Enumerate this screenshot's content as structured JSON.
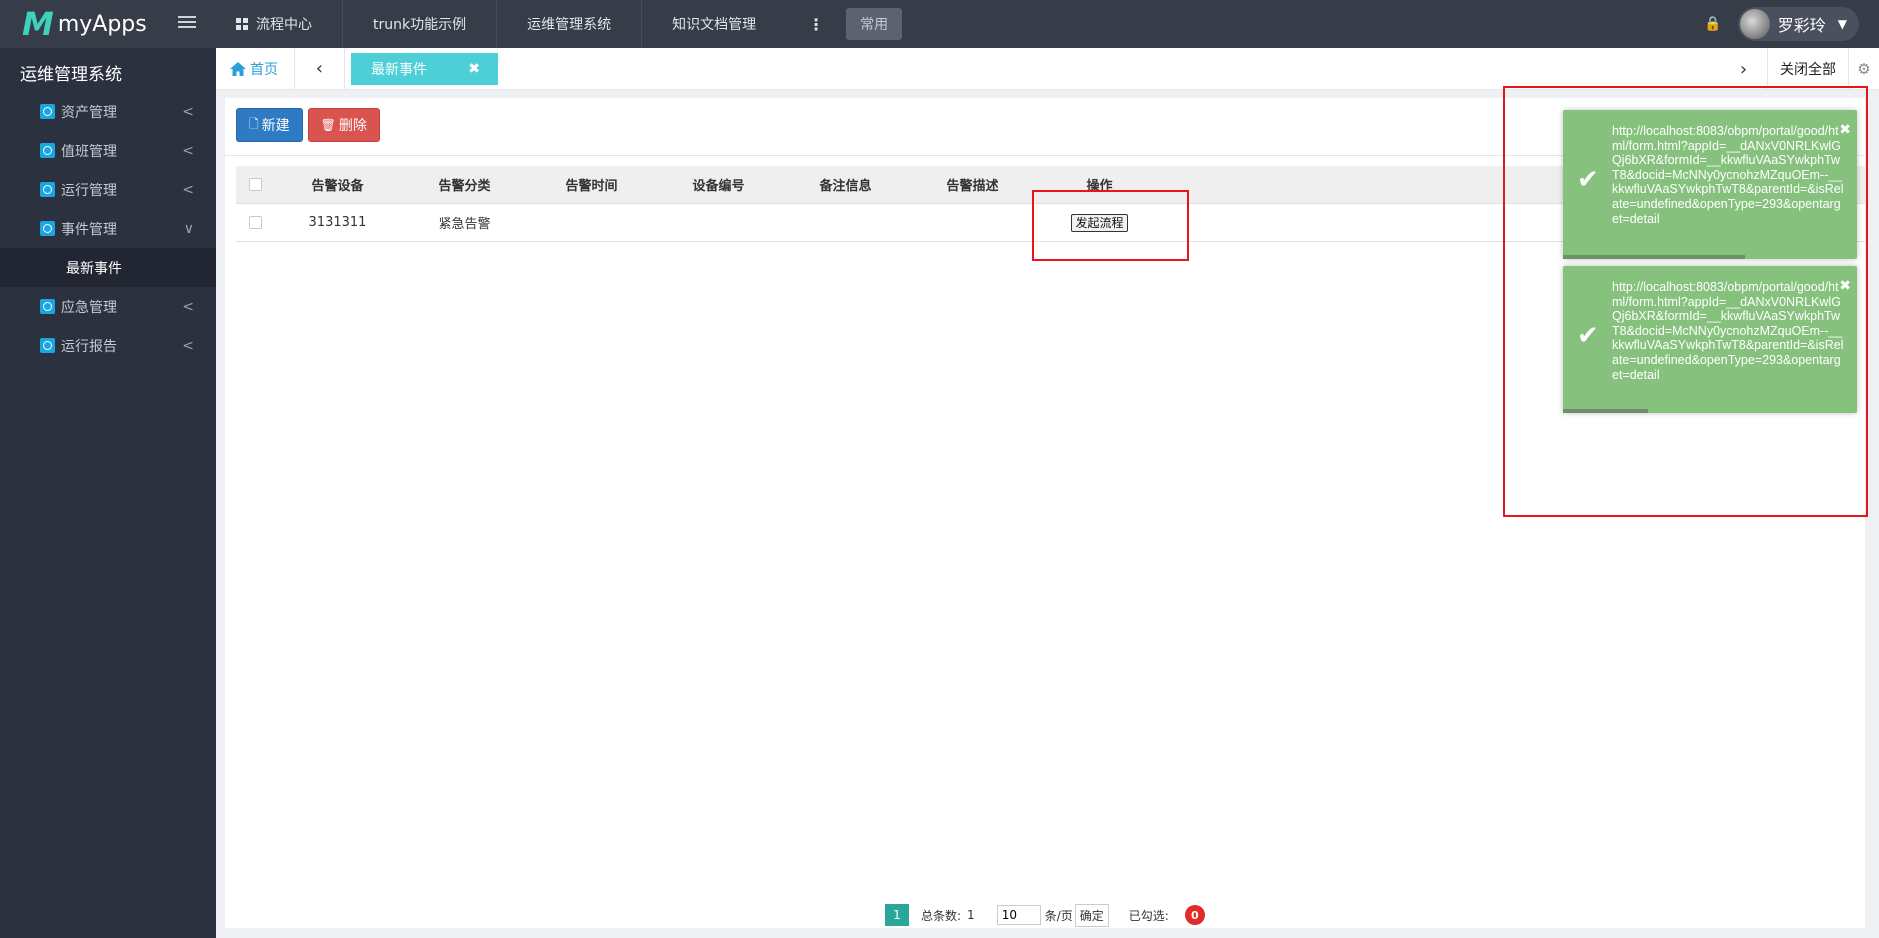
{
  "app": {
    "logo_mark": "M",
    "logo_text": "myApps"
  },
  "topnav": {
    "items": [
      "流程中心",
      "trunk功能示例",
      "运维管理系统",
      "知识文档管理"
    ],
    "more": "⋮",
    "common": "常用"
  },
  "user": {
    "name": "罗彩玲"
  },
  "sidebar": {
    "title": "运维管理系统",
    "items": [
      {
        "label": "资产管理"
      },
      {
        "label": "值班管理"
      },
      {
        "label": "运行管理"
      },
      {
        "label": "事件管理"
      },
      {
        "label": "应急管理"
      },
      {
        "label": "运行报告"
      }
    ],
    "sub_item": "最新事件"
  },
  "tabs": {
    "home": "首页",
    "active": "最新事件",
    "close_all": "关闭全部"
  },
  "toolbar": {
    "new_label": "新建",
    "delete_label": "删除"
  },
  "table": {
    "headers": [
      "告警设备",
      "告警分类",
      "告警时间",
      "设备编号",
      "备注信息",
      "告警描述",
      "操作"
    ],
    "rows": [
      {
        "device": "3131311",
        "category": "紧急告警",
        "time": "",
        "code": "",
        "remark": "",
        "desc": "",
        "action": "发起流程"
      }
    ]
  },
  "pager": {
    "page": "1",
    "total_label": "总条数:",
    "total": "1",
    "page_size": "10",
    "per_page_label": "条/页",
    "confirm": "确定",
    "selected_label": "已勾选:",
    "selected": "0"
  },
  "toasts": [
    {
      "message": "http://localhost:8083/obpm/portal/good/html/form.html?appId=__dANxV0NRLKwlGQj6bXR&formId=__kkwfluVAaSYwkphTwT8&docid=McNNy0ycnohzMZquOEm--__kkwfluVAaSYwkphTwT8&parentId=&isRelate=undefined&openType=293&opentarget=detail",
      "progress": 0.62
    },
    {
      "message": "http://localhost:8083/obpm/portal/good/html/form.html?appId=__dANxV0NRLKwlGQj6bXR&formId=__kkwfluVAaSYwkphTwT8&docid=McNNy0ycnohzMZquOEm--__kkwfluVAaSYwkphTwT8&parentId=&isRelate=undefined&openType=293&opentarget=detail",
      "progress": 0.29
    }
  ],
  "colors": {
    "accent": "#4dcfd8",
    "toast": "#86c27e",
    "highlight": "#e8151b",
    "sidebar": "#2c3140"
  }
}
